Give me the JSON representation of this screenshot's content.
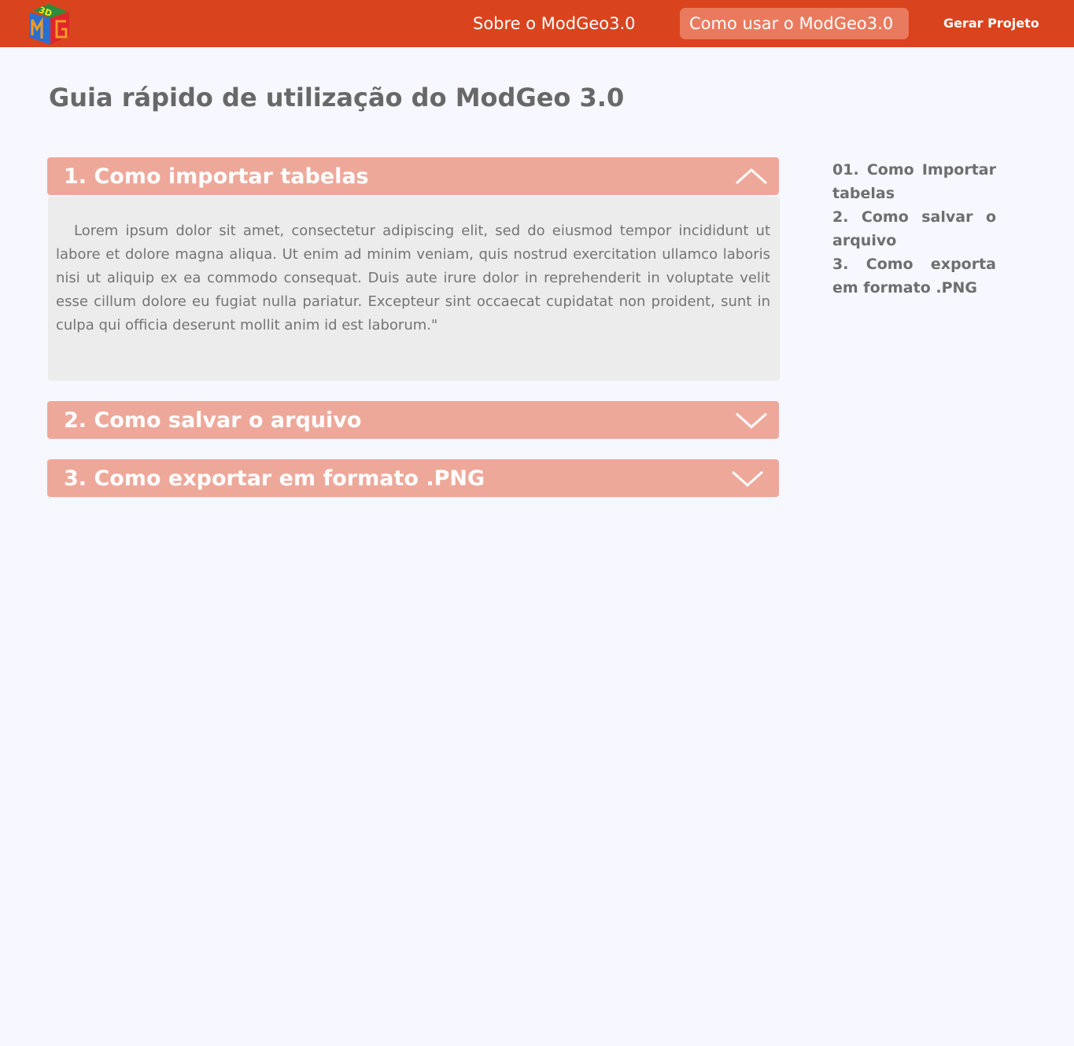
{
  "header": {
    "logo_text": "3D",
    "nav": {
      "about": "Sobre o ModGeo3.0",
      "how_to_use": "Como usar o ModGeo3.0",
      "generate": "Gerar Projeto"
    }
  },
  "main": {
    "title": "Guia rápido de utilização do ModGeo 3.0",
    "accordion": [
      {
        "label": "1. Como importar tabelas",
        "expanded": true,
        "icon": "chevron-up-icon",
        "body": "Lorem ipsum dolor sit amet, consectetur adipiscing elit, sed do eiusmod tempor incididunt ut labore et dolore magna aliqua. Ut enim ad minim veniam, quis nostrud exercitation ullamco laboris nisi ut aliquip ex ea commodo consequat. Duis aute irure dolor in reprehenderit in voluptate velit esse cillum dolore eu fugiat nulla pariatur. Excepteur sint occaecat cupidatat non proident, sunt in culpa qui officia deserunt mollit anim id est laborum.\""
      },
      {
        "label": "2. Como salvar o arquivo",
        "expanded": false,
        "icon": "chevron-down-icon"
      },
      {
        "label": "3. Como exportar em formato .PNG",
        "expanded": false,
        "icon": "chevron-down-icon"
      }
    ]
  },
  "sidebar": {
    "items": [
      "01. Como Importar tabelas",
      "2. Como salvar o arquivo",
      "3. Como exporta em formato .PNG"
    ]
  },
  "colors": {
    "header_bg": "#d9441e",
    "active_nav_bg": "#ea7a5e",
    "accordion_header_bg": "#eea89a",
    "accordion_body_bg": "#ececec",
    "page_bg": "#f6f7ff",
    "text_gray": "#686868"
  }
}
